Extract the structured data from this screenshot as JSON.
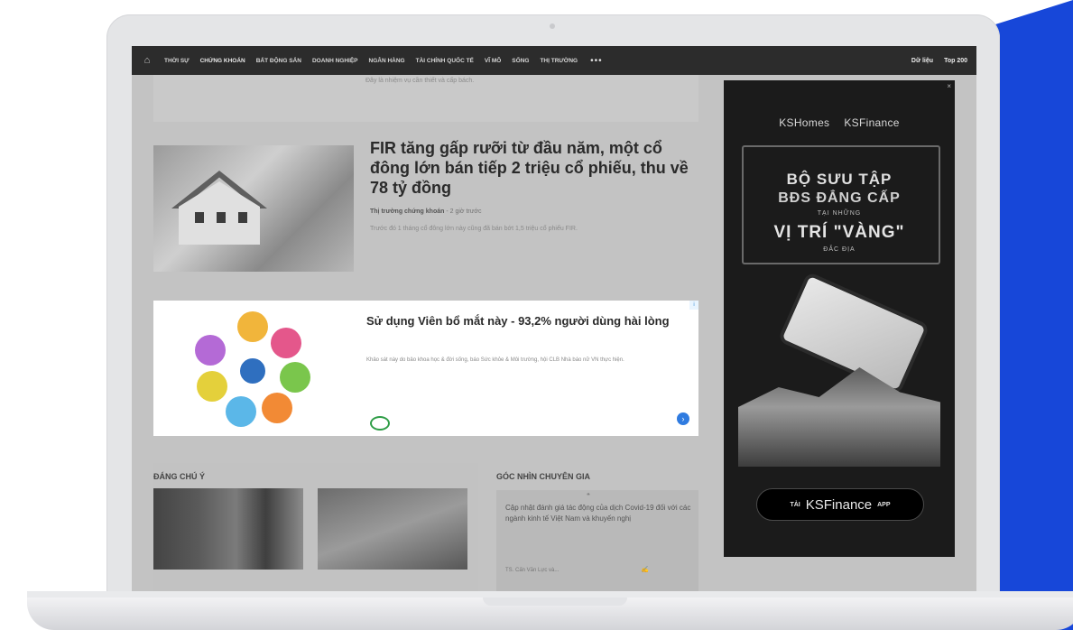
{
  "nav": {
    "items": [
      "THỜI SỰ",
      "CHỨNG KHOÁN",
      "BẤT ĐỘNG SẢN",
      "DOANH NGHIỆP",
      "NGÂN HÀNG",
      "TÀI CHÍNH QUỐC TẾ",
      "VĨ MÔ",
      "SỐNG",
      "THỊ TRƯỜNG"
    ],
    "more": "•••",
    "right": [
      "Dữ liệu",
      "Top 200"
    ]
  },
  "top_snippet": "Đây là nhiệm vụ cần thiết và cấp bách.",
  "article": {
    "title": "FIR tăng gấp rưỡi từ đầu năm, một cổ đông lớn bán tiếp 2 triệu cổ phiếu, thu về 78 tỷ đồng",
    "category": "Thị trường chứng khoán",
    "time": "- 2 giờ trước",
    "desc": "Trước đó 1 tháng cổ đông lớn này cũng đã bán bớt 1,5 triệu cổ phiếu FIR."
  },
  "ad": {
    "title": "Sử dụng Viên bổ mắt này - 93,2% người dùng hài lòng",
    "desc": "Khảo sát này do bảo khoa học & đời sống, báo Sức khỏe & Môi trường, hội CLB Nhà báo nữ VN thực hiện.",
    "badge": "i",
    "go": "›"
  },
  "sections": {
    "left_title": "ĐÁNG CHÚ Ý",
    "right_title": "GÓC NHÌN CHUYÊN GIA",
    "expert_text": "Cập nhật đánh giá tác động của dịch Covid-19 đối với các ngành kinh tế Việt Nam và khuyến nghị",
    "expert_author": "TS. Cấn Văn Lực và..."
  },
  "banner": {
    "close": "×",
    "logo1": "KSHomes",
    "logo2": "KSFinance",
    "line1": "BỘ SƯU TẬP",
    "line2": "BĐS ĐẲNG CẤP",
    "line3": "TẠI NHỮNG",
    "line4": "VỊ TRÍ \"VÀNG\"",
    "line5": "ĐẮC ĐỊA",
    "cta_small": "TẢI",
    "cta_big": "KSFinance",
    "cta_app": "APP"
  },
  "colors": {
    "nav_bg": "#2c2c2c",
    "blue_bg": "#1747d9",
    "ad_button": "#2f7be0"
  }
}
